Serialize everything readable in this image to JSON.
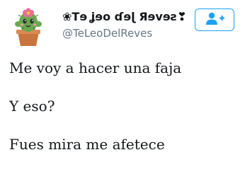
{
  "profile": {
    "display_name": "❀Tɘ ʝɘo ɗɘɭ Яɘvɘƨ❣",
    "handle": "@TeLeoDelReves",
    "avatar_icon": "cactus-avatar-icon"
  },
  "follow_button": {
    "icon": "follow-user-plus-icon",
    "color": "#1da1f2"
  },
  "tweet": {
    "lines": [
      "Me voy a hacer una faja",
      "Y eso?",
      "Fues mira me afetece"
    ]
  }
}
